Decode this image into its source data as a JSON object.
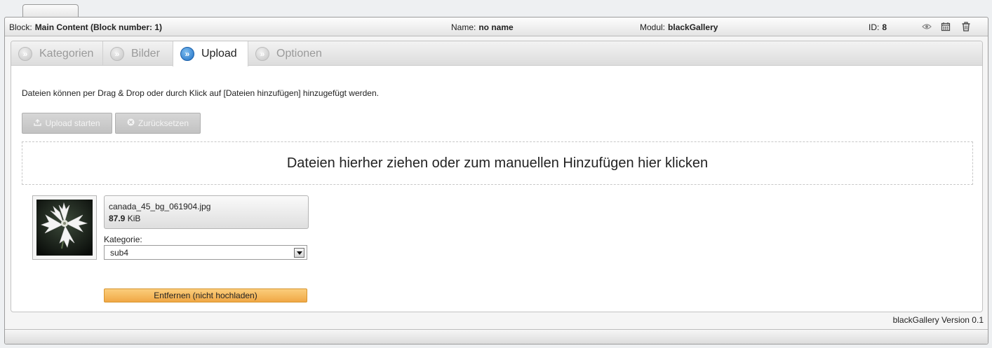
{
  "infobar": {
    "block_label": "Block:",
    "block_value": "Main Content (Block number: 1)",
    "name_label": "Name:",
    "name_value": "no name",
    "modul_label": "Modul:",
    "modul_value": "blackGallery",
    "id_label": "ID:",
    "id_value": "8",
    "icons": [
      "eye-icon",
      "calendar-icon",
      "trash-icon"
    ]
  },
  "tabs": [
    {
      "label": "Kategorien",
      "active": false
    },
    {
      "label": "Bilder",
      "active": false
    },
    {
      "label": "Upload",
      "active": true
    },
    {
      "label": "Optionen",
      "active": false
    }
  ],
  "upload": {
    "help_text": "Dateien können per Drag & Drop oder durch Klick auf [Dateien hinzufügen] hinzugefügt werden.",
    "start_button": "Upload starten",
    "reset_button": "Zurücksetzen",
    "dropzone_text": "Dateien hierher ziehen oder zum manuellen Hinzufügen hier klicken"
  },
  "file": {
    "name": "canada_45_bg_061904.jpg",
    "size_value": "87.9",
    "size_unit": "KiB",
    "category_label": "Kategorie:",
    "category_selected": "sub4",
    "remove_button": "Entfernen (nicht hochladen)"
  },
  "footer": {
    "version": "blackGallery Version 0.1"
  },
  "colors": {
    "active_tab_bullet": "#1e6fc4",
    "remove_button": "#f0a845",
    "disabled_button": "#c8c8c8"
  }
}
